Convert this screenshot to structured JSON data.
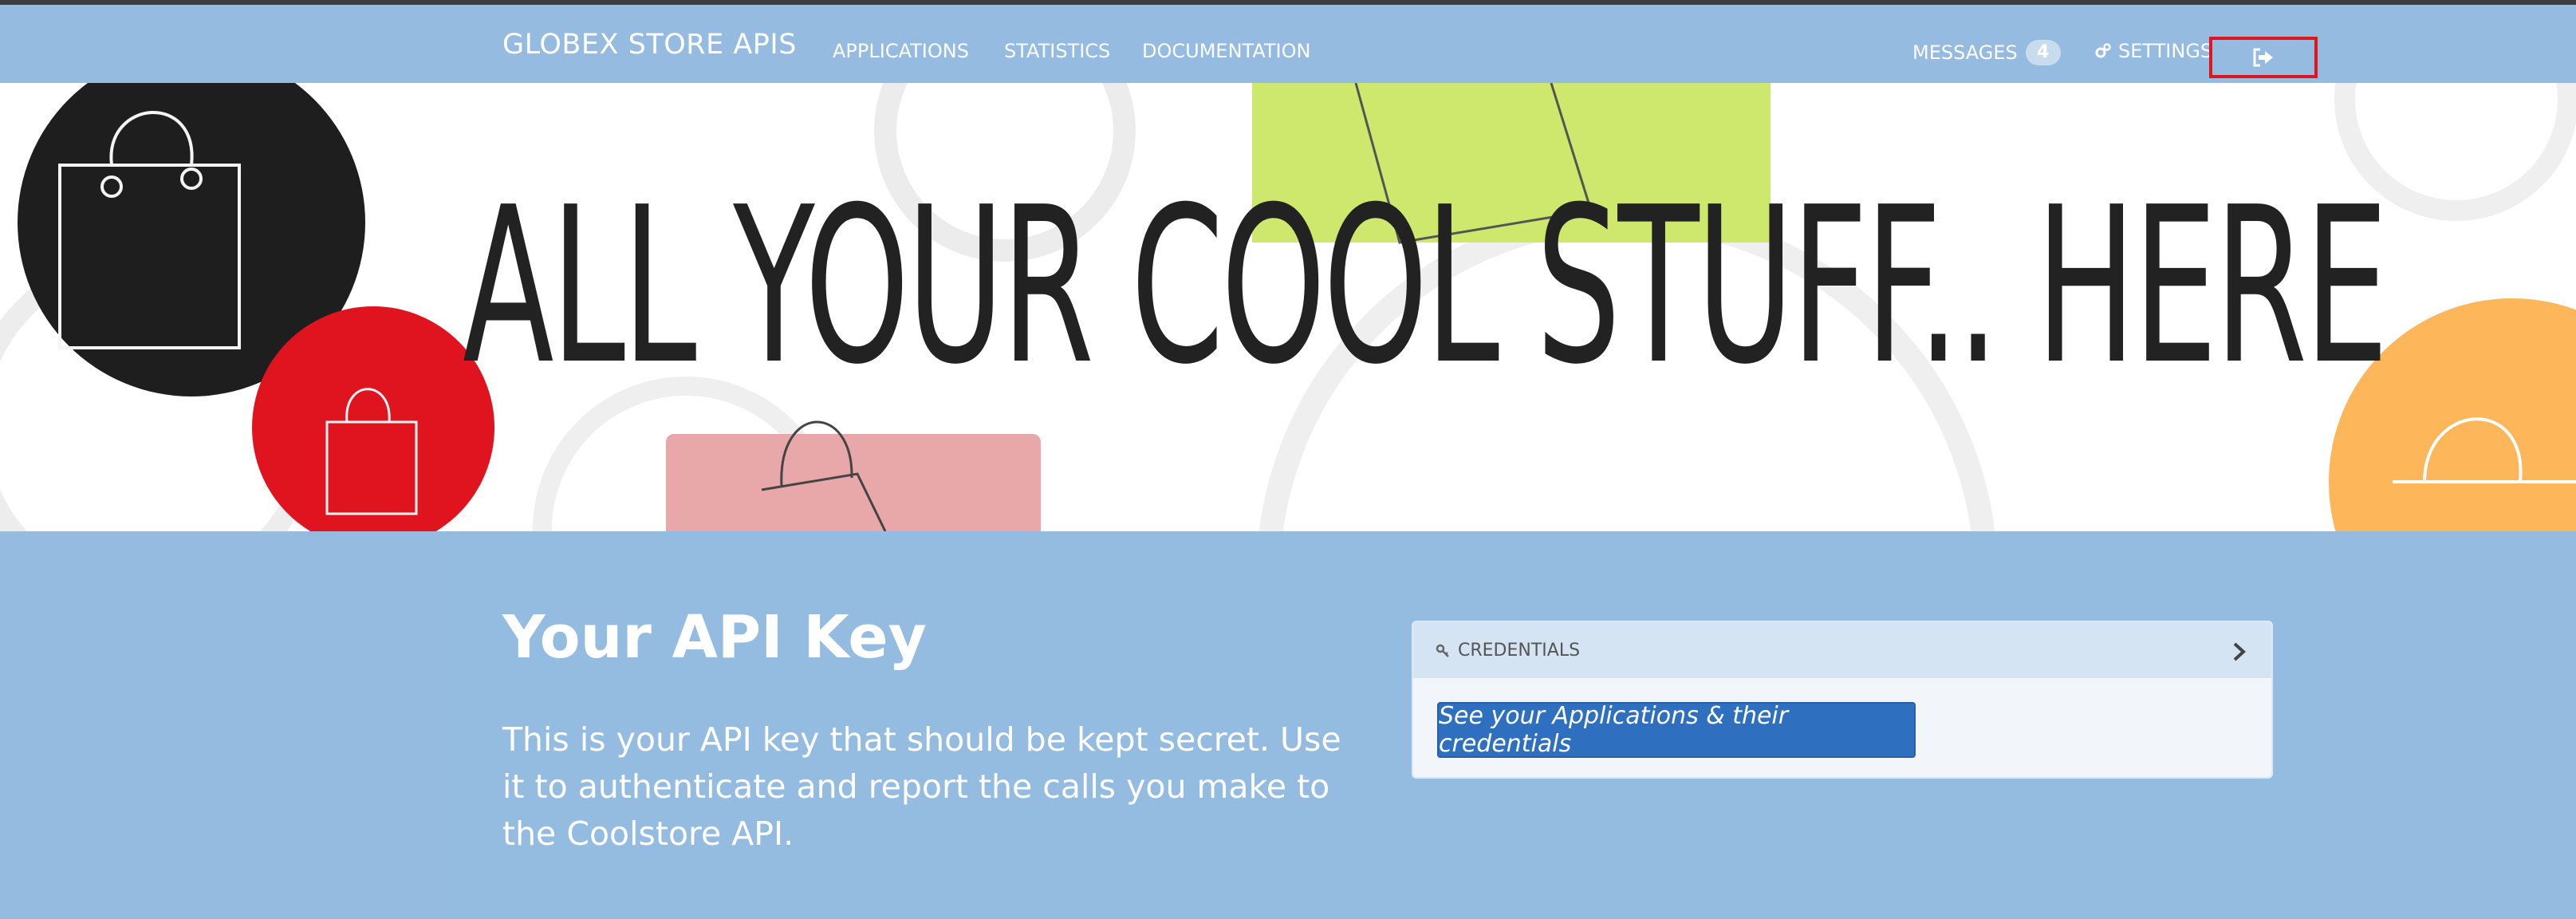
{
  "navbar": {
    "brand": "GLOBEX STORE APIS",
    "links": {
      "applications": "APPLICATIONS",
      "statistics": "STATISTICS",
      "documentation": "DOCUMENTATION"
    },
    "messages_label": "MESSAGES",
    "messages_count": "4",
    "settings_label": "SETTINGS",
    "icons": {
      "settings": "gears-icon",
      "logout": "sign-out-icon"
    }
  },
  "hero": {
    "headline": "ALL YOUR COOL STUFF.. HERE",
    "colors": {
      "black_circle": "#1e1e1e",
      "red_circle": "#e0141e",
      "green_square": "#cde86d",
      "pink_square": "#e8a8aa",
      "orange_circle": "#fdb65a"
    }
  },
  "main": {
    "title": "Your API Key",
    "description": "This is your API key that should be kept secret. Use it to authenticate and report the calls you make to the Coolstore API."
  },
  "credentials_panel": {
    "title": "CREDENTIALS",
    "button_label": "See your Applications & their credentials",
    "icons": {
      "header": "key-icon",
      "toggle": "chevron-right-icon"
    }
  },
  "colors": {
    "accent": "#96bbe0",
    "button": "#2f6fc0",
    "highlight_box": "#e0161e"
  }
}
